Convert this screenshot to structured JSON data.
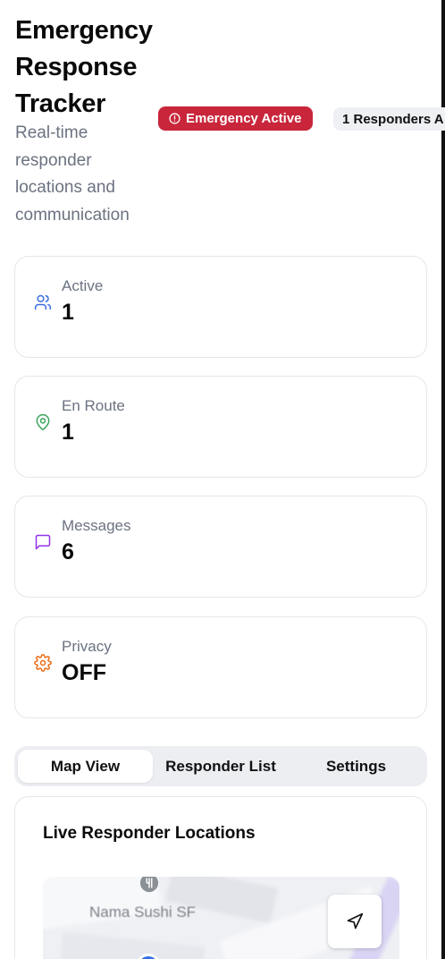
{
  "header": {
    "title": "Emergency Response Tracker",
    "subtitle": "Real-time responder locations and communication",
    "badge_emergency": "Emergency Active",
    "badge_responders": "1 Responders A"
  },
  "stats": [
    {
      "label": "Active",
      "value": "1",
      "icon": "users-icon",
      "color": "#3b6fe0"
    },
    {
      "label": "En Route",
      "value": "1",
      "icon": "map-pin-icon",
      "color": "#3aa55a"
    },
    {
      "label": "Messages",
      "value": "6",
      "icon": "message-square-icon",
      "color": "#9333ea"
    },
    {
      "label": "Privacy",
      "value": "OFF",
      "icon": "settings-icon",
      "color": "#ea6a12"
    }
  ],
  "tabs": [
    {
      "label": "Map View",
      "active": true
    },
    {
      "label": "Responder List",
      "active": false
    },
    {
      "label": "Settings",
      "active": false
    }
  ],
  "map": {
    "title": "Live Responder Locations",
    "place_label": "Nama Sushi SF",
    "locate_icon": "navigation-icon"
  },
  "colors": {
    "danger": "#c9263b",
    "muted_text": "#6b7280",
    "tabs_bg": "#eceef2",
    "pin": "#2f6fe4"
  }
}
